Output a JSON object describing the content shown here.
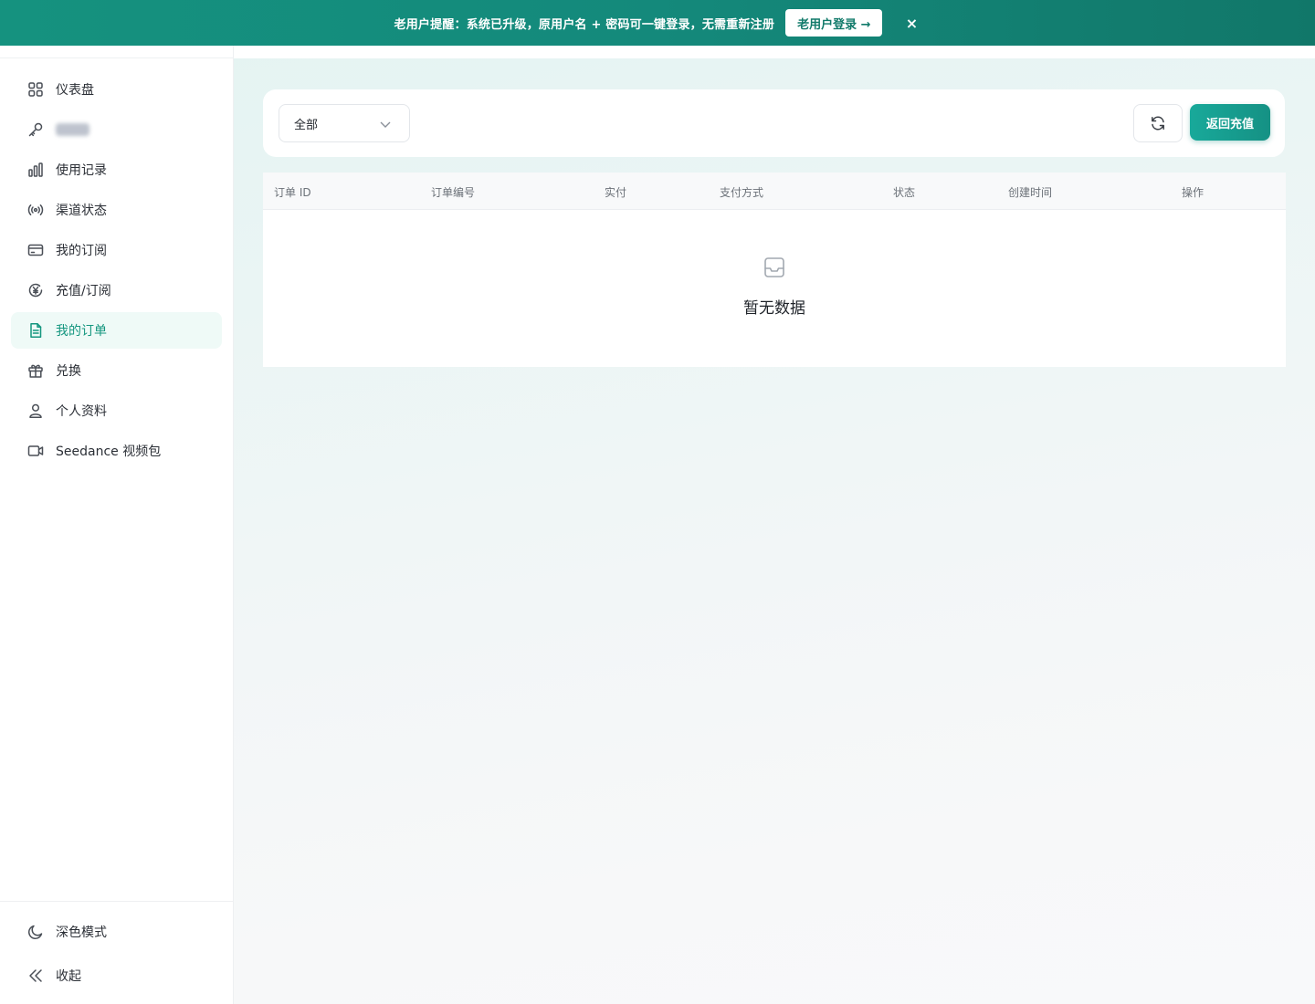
{
  "banner": {
    "message": "老用户提醒：系统已升级，原用户名 + 密码可一键登录，无需重新注册",
    "button_label": "老用户登录 →",
    "close_label": "×"
  },
  "sidebar": {
    "items": [
      {
        "label": "仪表盘",
        "icon": "grid-icon"
      },
      {
        "label": "",
        "icon": "key-icon"
      },
      {
        "label": "使用记录",
        "icon": "bar-chart-icon"
      },
      {
        "label": "渠道状态",
        "icon": "broadcast-icon"
      },
      {
        "label": "我的订阅",
        "icon": "credit-card-icon"
      },
      {
        "label": "充值/订阅",
        "icon": "yen-circle-icon"
      },
      {
        "label": "我的订单",
        "icon": "document-icon",
        "active": true
      },
      {
        "label": "兑换",
        "icon": "gift-icon"
      },
      {
        "label": "个人资料",
        "icon": "user-icon"
      },
      {
        "label": "Seedance 视频包",
        "icon": "video-icon"
      }
    ],
    "dark_mode_label": "深色模式",
    "collapse_label": "收起"
  },
  "toolbar": {
    "filter_value": "全部",
    "return_label": "返回充值"
  },
  "table": {
    "columns": [
      "订单 ID",
      "订单编号",
      "实付",
      "支付方式",
      "状态",
      "创建时间",
      "操作"
    ],
    "empty_text": "暂无数据"
  },
  "colors": {
    "brand": "#14967f",
    "banner": "#15927f",
    "active_bg": "#effaf7"
  }
}
